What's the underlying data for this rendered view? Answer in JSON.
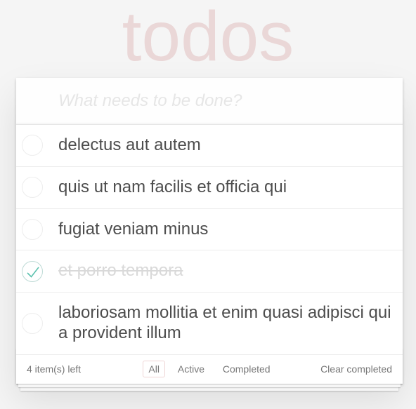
{
  "header": {
    "title": "todos"
  },
  "new_todo": {
    "placeholder": "What needs to be done?",
    "value": ""
  },
  "todos": [
    {
      "label": "delectus aut autem",
      "completed": false
    },
    {
      "label": "quis ut nam facilis et officia qui",
      "completed": false
    },
    {
      "label": "fugiat veniam minus",
      "completed": false
    },
    {
      "label": "et porro tempora",
      "completed": true
    },
    {
      "label": "laboriosam mollitia et enim quasi adipisci qui a provident illum",
      "completed": false
    }
  ],
  "footer": {
    "count_text": "4 item(s) left",
    "filters": [
      {
        "label": "All",
        "selected": true
      },
      {
        "label": "Active",
        "selected": false
      },
      {
        "label": "Completed",
        "selected": false
      }
    ],
    "clear_label": "Clear completed"
  },
  "colors": {
    "title": "#ead7d7",
    "check": "#5dc2af",
    "completed_text": "#d9d9d9",
    "selected_border": "#efd5d5"
  },
  "icons": {
    "toggle_checked": "check-icon"
  }
}
